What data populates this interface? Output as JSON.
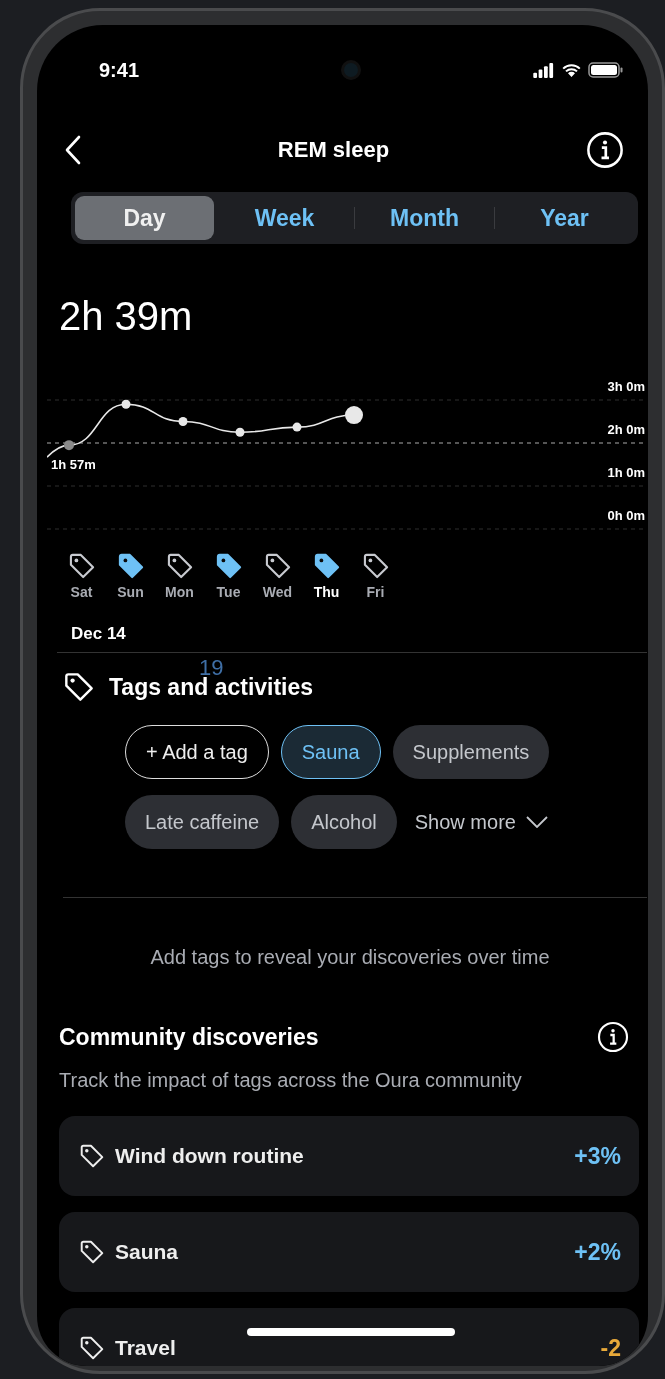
{
  "status_bar": {
    "time": "9:41"
  },
  "header": {
    "title": "REM sleep"
  },
  "tabs": [
    {
      "label": "Day",
      "selected": true
    },
    {
      "label": "Week",
      "selected": false
    },
    {
      "label": "Month",
      "selected": false
    },
    {
      "label": "Year",
      "selected": false
    }
  ],
  "summary": {
    "value": "2h 39m"
  },
  "chart": {
    "y_labels": [
      "3h 0m",
      "2h 0m",
      "1h 0m",
      "0h 0m"
    ],
    "point_label": "1h 57m"
  },
  "day_tags": [
    {
      "label": "Sat",
      "tagged": false,
      "selected": false
    },
    {
      "label": "Sun",
      "tagged": true,
      "selected": false
    },
    {
      "label": "Mon",
      "tagged": false,
      "selected": false
    },
    {
      "label": "Tue",
      "tagged": true,
      "selected": false
    },
    {
      "label": "Wed",
      "tagged": false,
      "selected": false
    },
    {
      "label": "Thu",
      "tagged": true,
      "selected": true
    },
    {
      "label": "Fri",
      "tagged": false,
      "selected": false
    }
  ],
  "date": "Dec 14",
  "overlay_text": "19",
  "tags_section": {
    "title": "Tags and activities",
    "chips": [
      {
        "label": "+ Add a tag",
        "kind": "add",
        "selected": false
      },
      {
        "label": "Sauna",
        "kind": "tag",
        "selected": true
      },
      {
        "label": "Supplements",
        "kind": "tag",
        "selected": false
      },
      {
        "label": "Late caffeine",
        "kind": "tag",
        "selected": false
      },
      {
        "label": "Alcohol",
        "kind": "tag",
        "selected": false
      }
    ],
    "show_more": "Show more"
  },
  "hint": "Add tags to reveal your discoveries over time",
  "community": {
    "title": "Community discoveries",
    "subtitle": "Track the impact of tags across the Oura community",
    "items": [
      {
        "label": "Wind down routine",
        "change": "+3%",
        "color": "#6ec1f5"
      },
      {
        "label": "Sauna",
        "change": "+2%",
        "color": "#6ec1f5"
      },
      {
        "label": "Travel",
        "change": "-2",
        "color": "#e8a93a"
      }
    ]
  }
}
